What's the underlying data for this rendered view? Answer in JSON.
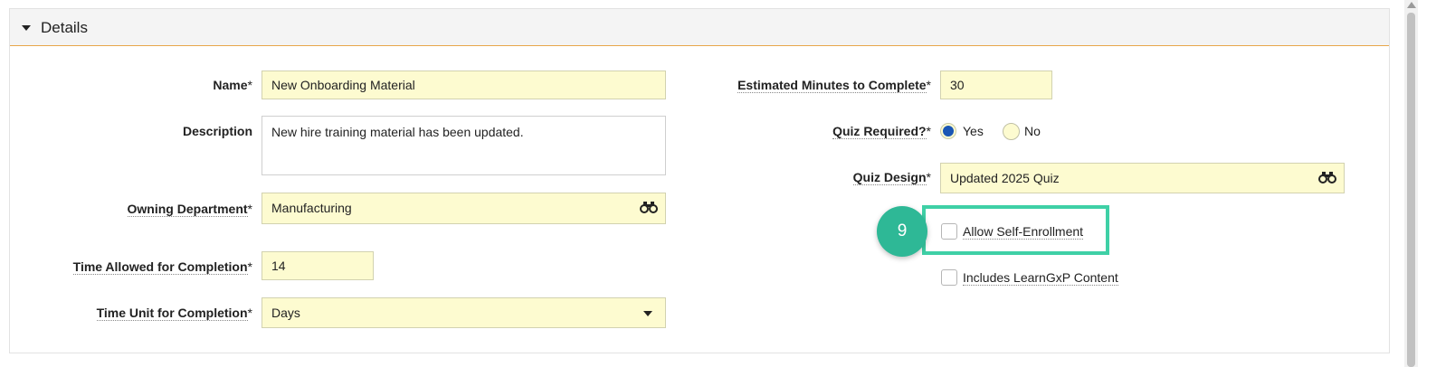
{
  "section": {
    "title": "Details"
  },
  "fields": {
    "name": {
      "label": "Name",
      "required": "*",
      "value": "New Onboarding Material"
    },
    "description": {
      "label": "Description",
      "value": "New hire training material has been updated."
    },
    "owning_department": {
      "label": "Owning Department",
      "required": "*",
      "value": "Manufacturing"
    },
    "time_allowed": {
      "label": "Time Allowed for Completion",
      "required": "*",
      "value": "14"
    },
    "time_unit": {
      "label": "Time Unit for Completion",
      "required": "*",
      "value": "Days"
    },
    "estimated_minutes": {
      "label": "Estimated Minutes to Complete",
      "required": "*",
      "value": "30"
    },
    "quiz_required": {
      "label": "Quiz Required?",
      "required": "*",
      "options": [
        "Yes",
        "No"
      ],
      "selected": "Yes"
    },
    "quiz_design": {
      "label": "Quiz Design",
      "required": "*",
      "value": "Updated 2025 Quiz"
    }
  },
  "checkboxes": {
    "allow_self_enrollment": {
      "label": "Allow Self-Enrollment",
      "checked": false
    },
    "includes_learngxp": {
      "label": "Includes LearnGxP Content",
      "checked": false
    }
  },
  "annotation": {
    "step": "9",
    "color": "#3fd0a6"
  },
  "icons": {
    "lookup": "binoculars-icon",
    "dropdown": "chevron-down-icon",
    "collapse": "caret-down-icon"
  },
  "colors": {
    "field_bg": "#fdfbd0",
    "header_border": "#e8a64a",
    "radio_selected": "#1a56b5"
  }
}
